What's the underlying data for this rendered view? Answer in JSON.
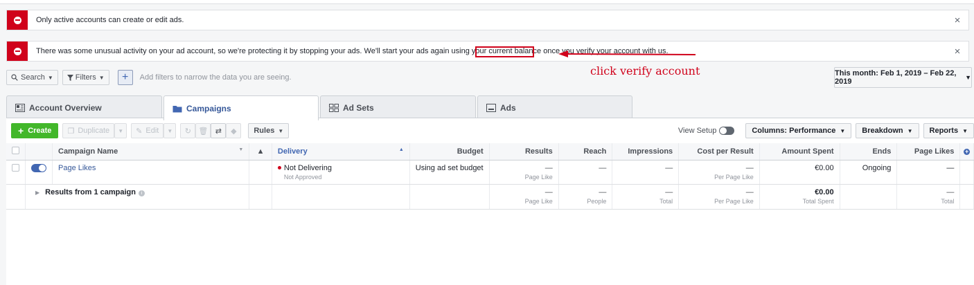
{
  "alerts": [
    {
      "message": "Only active accounts can create or edit ads.",
      "close": "×"
    },
    {
      "message_before": "There was some unusual activity on your ad account, so we're protecting it by stopping your ads. We'll start your ads again using your current balance once you ",
      "link": "verify your account",
      "message_after": " with us.",
      "close": "×"
    }
  ],
  "annotation": {
    "text": "click verify account",
    "color": "#d0021b"
  },
  "filters": {
    "search_label": "Search",
    "filters_label": "Filters",
    "add_label": "+",
    "hint": "Add filters to narrow the data you are seeing.",
    "date_range": "This month: Feb 1, 2019 – Feb 22, 2019"
  },
  "tabs": [
    {
      "label": "Account Overview",
      "icon": "account-overview-icon"
    },
    {
      "label": "Campaigns",
      "icon": "folder-icon",
      "active": true
    },
    {
      "label": "Ad Sets",
      "icon": "grid-icon"
    },
    {
      "label": "Ads",
      "icon": "ad-icon"
    }
  ],
  "toolbar": {
    "create": "Create",
    "duplicate": "Duplicate",
    "edit": "Edit",
    "rules": "Rules",
    "view_setup": "View Setup",
    "columns": "Columns: Performance",
    "breakdown": "Breakdown",
    "reports": "Reports"
  },
  "table": {
    "headers": [
      "Campaign Name",
      "Delivery",
      "Budget",
      "Results",
      "Reach",
      "Impressions",
      "Cost per Result",
      "Amount Spent",
      "Ends",
      "Page Likes"
    ],
    "rows": [
      {
        "name": "Page Likes",
        "delivery": "Not Delivering",
        "delivery_sub": "Not Approved",
        "budget": "Using ad set budget",
        "results": "—",
        "results_sub": "Page Like",
        "reach": "—",
        "impressions": "—",
        "cost": "—",
        "cost_sub": "Per Page Like",
        "spent": "€0.00",
        "ends": "Ongoing",
        "page_likes": "—"
      }
    ],
    "summary": {
      "label": "Results from 1 campaign",
      "results": "—",
      "results_sub": "Page Like",
      "reach": "—",
      "reach_sub": "People",
      "impressions": "—",
      "impressions_sub": "Total",
      "cost": "—",
      "cost_sub": "Per Page Like",
      "spent": "€0.00",
      "spent_sub": "Total Spent",
      "page_likes": "—",
      "page_likes_sub": "Total"
    }
  },
  "colors": {
    "accent": "#4267b2",
    "alert": "#d0021b",
    "create": "#42b72a"
  }
}
